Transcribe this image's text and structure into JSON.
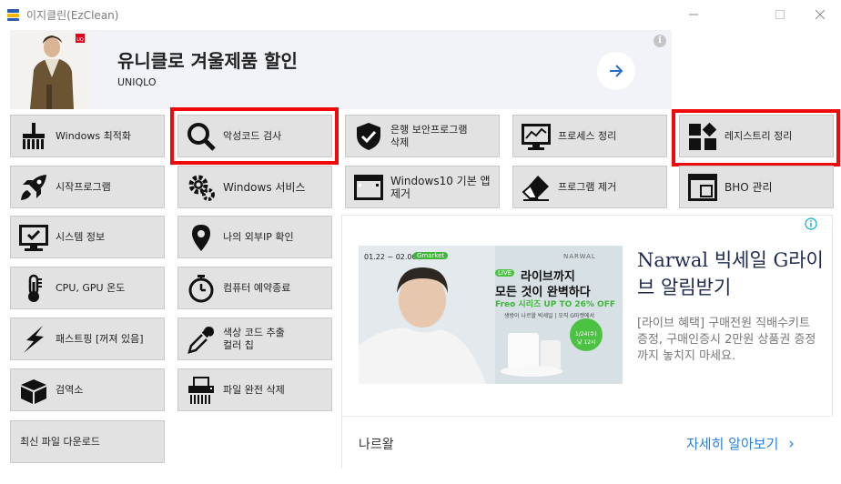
{
  "window": {
    "title": "이지클린(EzClean)",
    "controls": {
      "minimize": "—",
      "maximize": "☐",
      "close": "✕"
    }
  },
  "top_banner": {
    "headline": "유니클로 겨울제품 할인",
    "brand": "UNIQLO",
    "info": "i"
  },
  "tools": {
    "windows_optimize": "Windows 최적화",
    "malware_scan": "악성코드 검사",
    "bank_security": "은행 보안프로그램\n삭제",
    "process_cleanup": "프로세스 정리",
    "registry_cleanup": "레지스트리 정리",
    "startup_programs": "시작프로그램",
    "windows_services": "Windows 서비스",
    "win10_default_apps": "Windows10 기본 앱\n제거",
    "program_remove": "프로그램 제거",
    "bho_manage": "BHO 관리",
    "system_info": "시스템 정보",
    "my_external_ip": "나의 외부IP 확인",
    "cpu_gpu_temp": "CPU, GPU 온도",
    "scheduled_shutdown": "컴퓨터 예약종료",
    "fast_ping": "패스트핑 [꺼져 있음]",
    "color_picker": "색상 코드 추출\n컬러 칩",
    "search": "검역소",
    "file_shred": "파일 완전 삭제",
    "latest_download": "최신 파일 다운로드"
  },
  "highlighted_tools": [
    "malware_scan",
    "registry_cleanup"
  ],
  "side_ad": {
    "image": {
      "date_range": "01.22 ~ 02.06",
      "market": "Gmarket",
      "brand": "NARWAL",
      "live_badge": "LIVE",
      "line1": "라이브까지",
      "line2": "모든 것이 완벽하다",
      "line3": "Freo 시리즈 UP TO 26% OFF",
      "line4": "생방이 나르왈 빅세일 | 오직 G마켓에서",
      "live_date": "1/24(수)",
      "live_time": "낮 12시"
    },
    "headline": "Narwal 빅세일 G라이브 알림받기",
    "description": "[라이브 혜택] 구매전원 직배수키트 증정, 구매인증시 2만원 상품권 증정까지 놓치지 마세요.",
    "advertiser": "나르왈",
    "cta": "자세히 알아보기",
    "cta_icon": "›"
  },
  "colors": {
    "highlight": "#ee0a0a",
    "tool_bg": "#e2e2e2",
    "cta": "#2c80d8",
    "ad_headline": "#1e2a50"
  }
}
